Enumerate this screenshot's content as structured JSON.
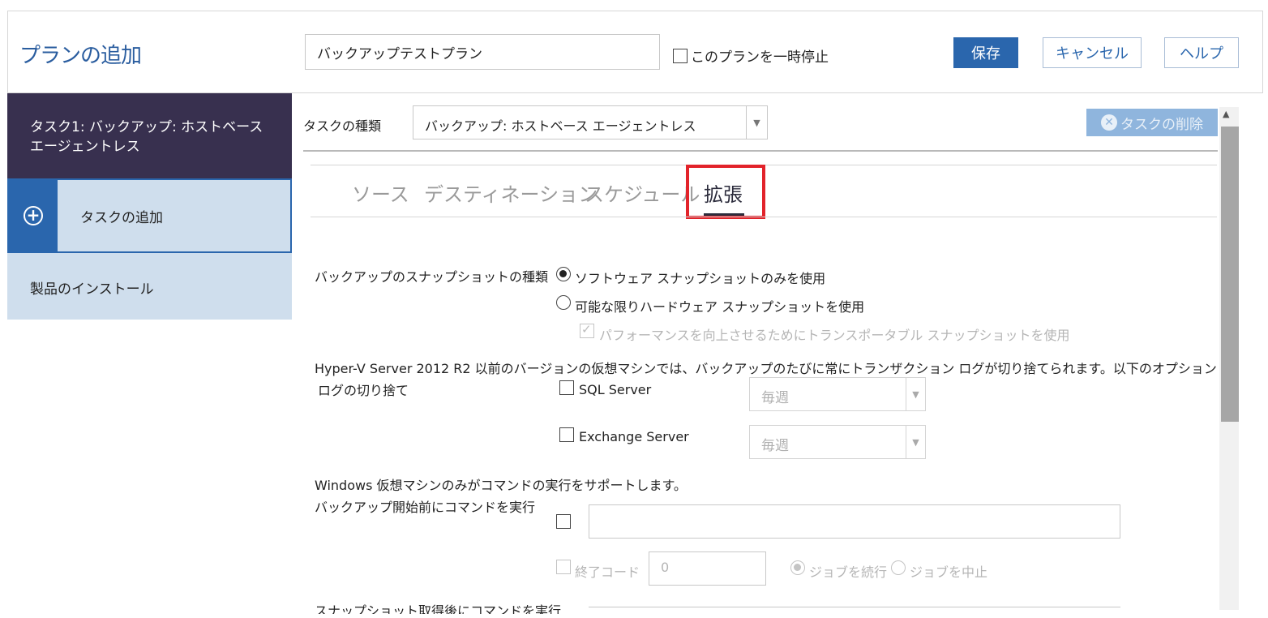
{
  "header": {
    "title": "プランの追加",
    "plan_name_value": "バックアップテストプラン",
    "pause_label": "このプランを一時停止",
    "save_label": "保存",
    "cancel_label": "キャンセル",
    "help_label": "ヘルプ"
  },
  "sidebar": {
    "task_label": "タスク1: バックアップ: ホストベース エージェントレス",
    "add_task_label": "タスクの追加",
    "install_label": "製品のインストール"
  },
  "task": {
    "type_label": "タスクの種類",
    "type_value": "バックアップ: ホストベース エージェントレス",
    "delete_label": "タスクの削除"
  },
  "tabs": [
    {
      "label": "ソース"
    },
    {
      "label": "デスティネーション"
    },
    {
      "label": "スケジュール"
    },
    {
      "label": "拡張",
      "active": true
    }
  ],
  "advanced": {
    "snapshot_type_label": "バックアップのスナップショットの種類",
    "snapshot_opt_software": "ソフトウェア スナップショットのみを使用",
    "snapshot_opt_hardware": "可能な限りハードウェア スナップショットを使用",
    "transportable_label": "パフォーマンスを向上させるためにトランスポータブル スナップショットを使用",
    "hyperv_note": "Hyper-V Server 2012 R2 以前のバージョンの仮想マシンでは、バックアップのたびに常にトランザクション ログが切り捨てられます。以下のオプションは、vSphere、Nuta",
    "log_trunc_label": "ログの切り捨て",
    "sql_label": "SQL Server",
    "sql_freq": "毎週",
    "exchange_label": "Exchange Server",
    "exchange_freq": "毎週",
    "windows_note": "Windows 仮想マシンのみがコマンドの実行をサポートします。",
    "pre_cmd_label": "バックアップ開始前にコマンドを実行",
    "exit_code_label": "終了コード",
    "exit_code_value": "0",
    "continue_job_label": "ジョブを続行",
    "stop_job_label": "ジョブを中止",
    "post_snapshot_label": "スナップショット取得後にコマンドを実行"
  },
  "colors": {
    "accent": "#2a66ad",
    "sidebar_dark": "#38304f",
    "sidebar_light": "#cfdeed",
    "highlight": "#e2232a"
  }
}
